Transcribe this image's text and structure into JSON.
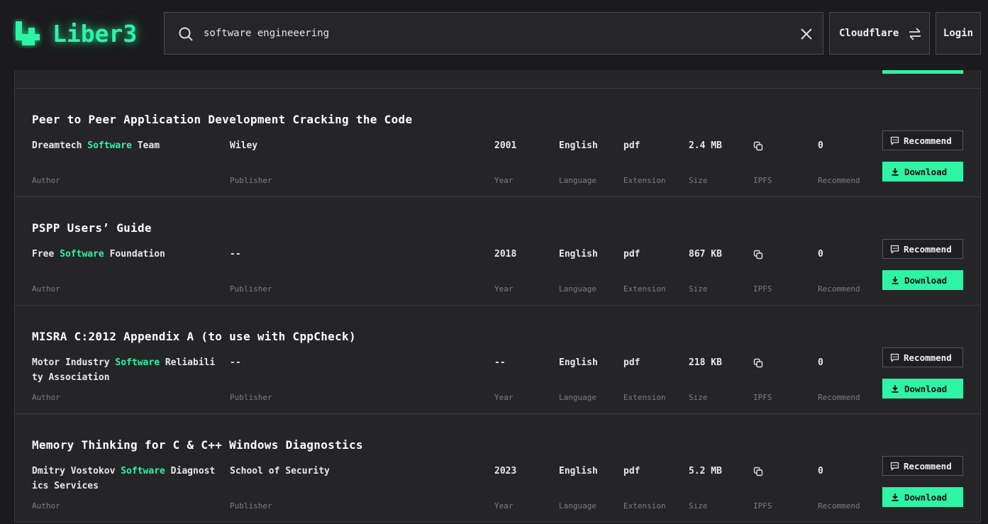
{
  "header": {
    "logo_text": "Liber3",
    "search_value": "software engineeering",
    "gateway_label": "Cloudflare",
    "login_label": "Login"
  },
  "labels": {
    "author": "Author",
    "publisher": "Publisher",
    "year": "Year",
    "language": "Language",
    "extension": "Extension",
    "size": "Size",
    "ipfs": "IPFS",
    "recommend": "Recommend",
    "recommend_button": "Recommend",
    "download_button": "Download"
  },
  "results": [
    {
      "title": "Peer to Peer Application Development Cracking the Code",
      "author_pre": "Dreamtech ",
      "author_hl": "Software",
      "author_post": " Team",
      "publisher": "Wiley",
      "year": "2001",
      "language": "English",
      "extension": "pdf",
      "size": "2.4 MB",
      "recommend": "0"
    },
    {
      "title": "PSPP Users’ Guide",
      "author_pre": "Free ",
      "author_hl": "Software",
      "author_post": " Foundation",
      "publisher": "--",
      "year": "2018",
      "language": "English",
      "extension": "pdf",
      "size": "867 KB",
      "recommend": "0"
    },
    {
      "title": "MISRA C:2012 Appendix A (to use with CppCheck)",
      "author_pre": "Motor Industry ",
      "author_hl": "Software",
      "author_post": " Reliability Association",
      "publisher": "--",
      "year": "--",
      "language": "English",
      "extension": "pdf",
      "size": "218 KB",
      "recommend": "0"
    },
    {
      "title": "Memory Thinking for C & C++ Windows Diagnostics",
      "author_pre": "Dmitry Vostokov ",
      "author_hl": "Software",
      "author_post": " Diagnostics Services",
      "publisher": "School of Security",
      "year": "2023",
      "language": "English",
      "extension": "pdf",
      "size": "5.2 MB",
      "recommend": "0"
    }
  ],
  "colors": {
    "accent": "#2ff3a5",
    "background": "#1b1b1d",
    "card": "#252528"
  }
}
